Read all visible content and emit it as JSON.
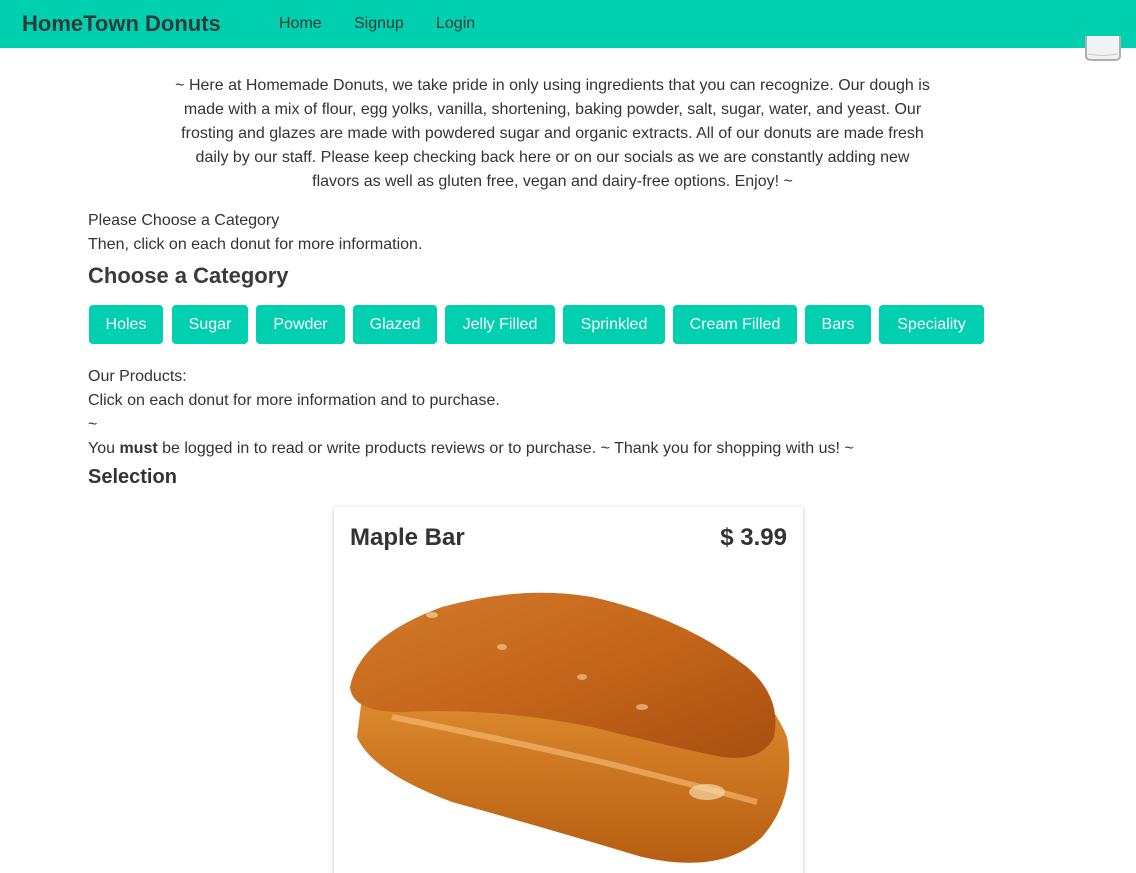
{
  "navbar": {
    "brand": "HomeTown Donuts",
    "links": [
      "Home",
      "Signup",
      "Login"
    ],
    "color": "#00cfb0"
  },
  "cart": {
    "icon": "shopping-cart-icon"
  },
  "intro": "~ Here at Homemade Donuts, we take pride in only using ingredients that you can recognize. Our dough is made with a mix of flour, egg yolks, vanilla, shortening, baking powder, salt, sugar, water, and yeast. Our frosting and glazes are made with powdered sugar and organic extracts. All of our donuts are made fresh daily by our staff. Please keep checking back here or on our socials as we are constantly adding new flavors as well as gluten free, vegan and dairy-free options. Enjoy! ~",
  "category_prompt": {
    "line1": "Please Choose a Category",
    "line2": "Then, click on each donut for more information."
  },
  "choose_heading": "Choose a Category",
  "categories": [
    "Holes",
    "Sugar",
    "Powder",
    "Glazed",
    "Jelly Filled",
    "Sprinkled",
    "Cream Filled",
    "Bars",
    "Speciality"
  ],
  "products_info": {
    "line1": "Our Products:",
    "line2": "Click on each donut for more information and to purchase.",
    "line3": "~",
    "notice_prefix": "You ",
    "notice_bold": "must",
    "notice_suffix": " be logged in to read or write products reviews or to purchase. ~ Thank you for shopping with us! ~"
  },
  "selection_heading": "Selection",
  "product": {
    "name": "Maple Bar",
    "price": "$ 3.99",
    "image": "maple-bar-donut"
  }
}
